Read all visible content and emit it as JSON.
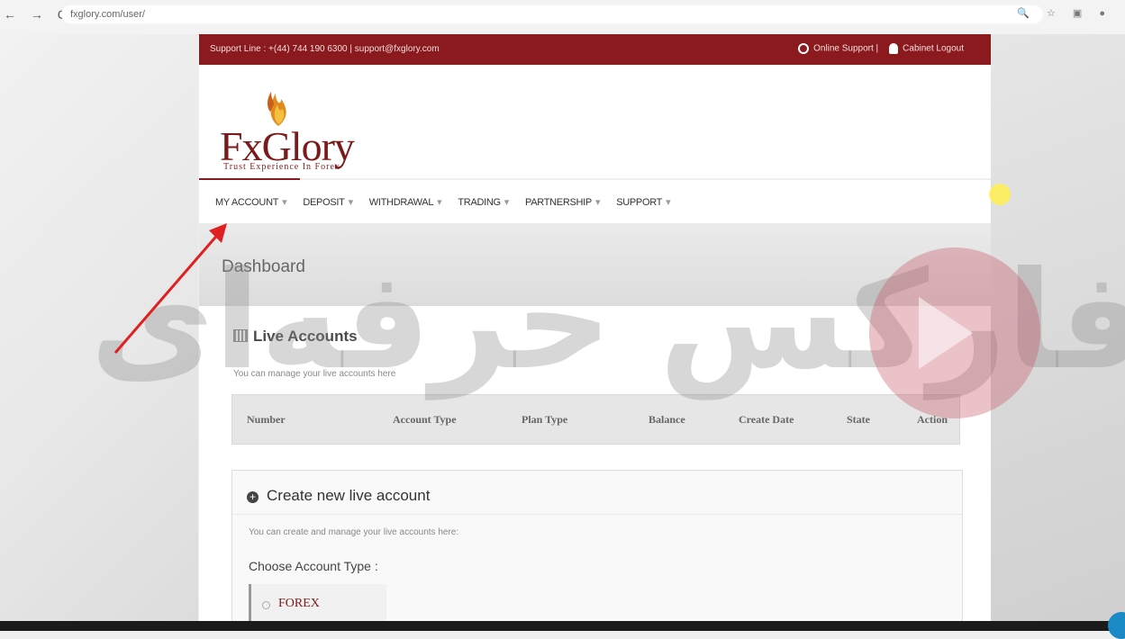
{
  "browser": {
    "nav": "← → C",
    "url": "fxglory.com/user/",
    "tools": "🔍 ☆ ▣ ●"
  },
  "topbar": {
    "contact": "Support Line : +(44) 744 190 6300  |  support@fxglory.com",
    "online_support": "Online Support |",
    "cabinet_logout": "Cabinet Logout"
  },
  "logo": {
    "text": "FxGlory",
    "tagline": "Trust Experience In Forex"
  },
  "nav": {
    "items": [
      "MY ACCOUNT",
      "DEPOSIT",
      "WITHDRAWAL",
      "TRADING",
      "PARTNERSHIP",
      "SUPPORT"
    ],
    "caret": "▾"
  },
  "dashboard": {
    "title": "Dashboard"
  },
  "live_accounts": {
    "title": "Live Accounts",
    "description": "You can manage your live accounts here",
    "columns": [
      "Number",
      "Account Type",
      "Plan Type",
      "Balance",
      "Create Date",
      "State",
      "Action"
    ]
  },
  "create_account": {
    "title": "Create new live account",
    "plus": "+",
    "description": "You can create and manage your live accounts here:",
    "choose_label": "Choose Account Type :",
    "option": "FOREX"
  },
  "watermark": {
    "text": "فارکس حرفه‌ای"
  },
  "colors": {
    "brand": "#8b1a1e",
    "arrow": "#e02020"
  }
}
